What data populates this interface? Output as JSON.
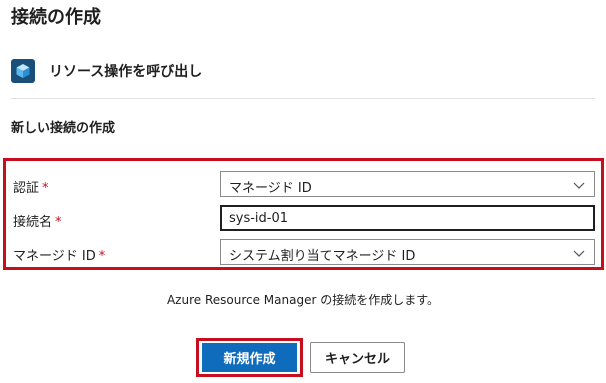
{
  "page": {
    "title": "接続の作成"
  },
  "connector": {
    "name": "リソース操作を呼び出し",
    "icon": "cube-icon"
  },
  "section": {
    "title": "新しい接続の作成"
  },
  "form": {
    "auth": {
      "label": "認証",
      "required_mark": "*",
      "value": "マネージド ID"
    },
    "connection_name": {
      "label": "接続名",
      "required_mark": "*",
      "value": "sys-id-01"
    },
    "managed_identity": {
      "label": "マネージド ID",
      "required_mark": "*",
      "value": "システム割り当てマネージド ID"
    }
  },
  "info": {
    "text": "Azure Resource Manager の接続を作成します。"
  },
  "buttons": {
    "create": "新規作成",
    "cancel": "キャンセル"
  },
  "colors": {
    "primary": "#0f6cbd",
    "highlight": "#c50f1f",
    "icon_bg": "#1a4f7a"
  }
}
